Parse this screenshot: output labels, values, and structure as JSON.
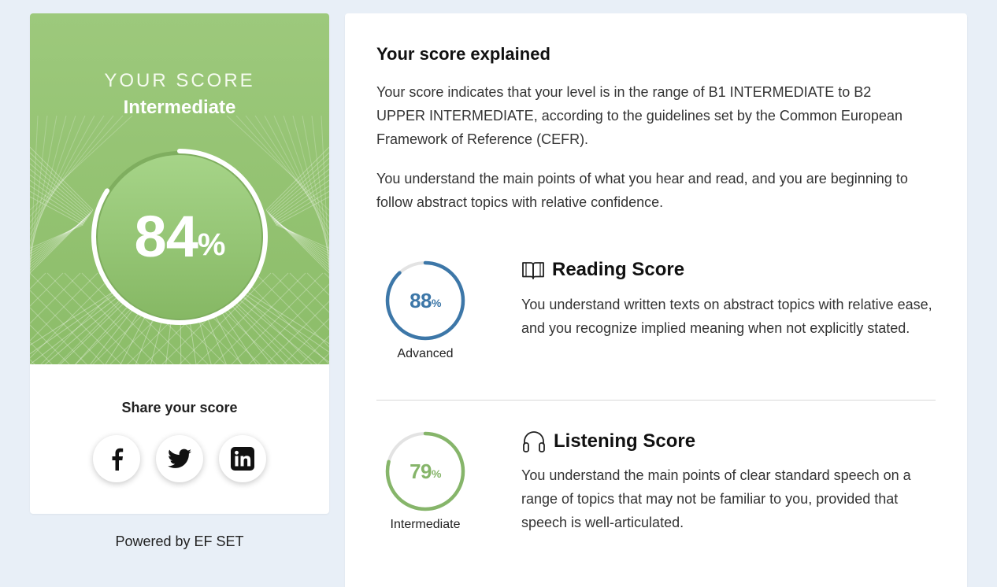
{
  "score_card": {
    "eyebrow": "YOUR SCORE",
    "level": "Intermediate",
    "score": 84,
    "score_number": "84",
    "percent_sign": "%",
    "share_title": "Share your score",
    "share_buttons": [
      "facebook-icon",
      "twitter-icon",
      "linkedin-icon"
    ],
    "powered_by": "Powered by EF SET",
    "colors": {
      "hero": "#93c271",
      "gauge_inner": "#8fc06d"
    }
  },
  "explained": {
    "title": "Your score explained",
    "paragraph_1": "Your score indicates that your level is in the range of B1 INTERMEDIATE to B2 UPPER INTERMEDIATE, according to the guidelines set by the Common European Framework of Reference (CEFR).",
    "paragraph_2": "You understand the main points of what you hear and read, and you are beginning to follow abstract topics with relative confidence."
  },
  "skills": [
    {
      "title": "Reading Score",
      "icon": "book-icon",
      "score": 88,
      "score_number": "88",
      "percent_sign": "%",
      "level": "Advanced",
      "color": "#3d77a8",
      "description": "You understand written texts on abstract topics with relative ease, and you recognize implied meaning when not explicitly stated."
    },
    {
      "title": "Listening Score",
      "icon": "headphones-icon",
      "score": 79,
      "score_number": "79",
      "percent_sign": "%",
      "level": "Intermediate",
      "color": "#86b56a",
      "description": "You understand the main points of clear standard speech on a range of topics that may not be familiar to you, provided that speech is well-articulated."
    }
  ]
}
